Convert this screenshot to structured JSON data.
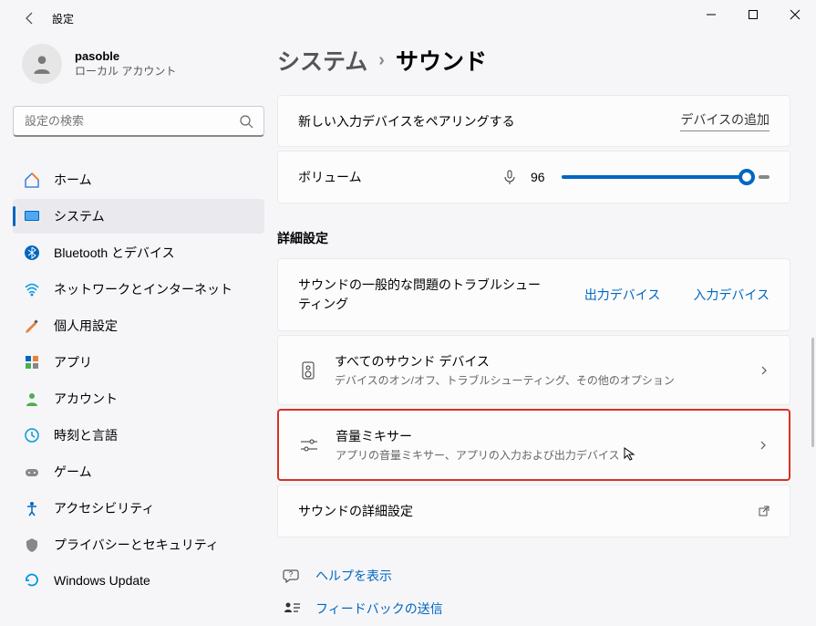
{
  "titlebar": {
    "title": "設定"
  },
  "profile": {
    "name": "pasoble",
    "subtitle": "ローカル アカウント"
  },
  "search": {
    "placeholder": "設定の検索"
  },
  "nav": [
    {
      "id": "home",
      "label": "ホーム"
    },
    {
      "id": "system",
      "label": "システム",
      "active": true
    },
    {
      "id": "bluetooth",
      "label": "Bluetooth とデバイス"
    },
    {
      "id": "network",
      "label": "ネットワークとインターネット"
    },
    {
      "id": "personalize",
      "label": "個人用設定"
    },
    {
      "id": "apps",
      "label": "アプリ"
    },
    {
      "id": "account",
      "label": "アカウント"
    },
    {
      "id": "time",
      "label": "時刻と言語"
    },
    {
      "id": "gaming",
      "label": "ゲーム"
    },
    {
      "id": "accessibility",
      "label": "アクセシビリティ"
    },
    {
      "id": "privacy",
      "label": "プライバシーとセキュリティ"
    },
    {
      "id": "update",
      "label": "Windows Update"
    }
  ],
  "breadcrumb": {
    "parent": "システム",
    "current": "サウンド"
  },
  "pairing": {
    "text": "新しい入力デバイスをペアリングする",
    "button": "デバイスの追加"
  },
  "volume": {
    "label": "ボリューム",
    "value": "96"
  },
  "advanced": {
    "title": "詳細設定",
    "troubleshoot": {
      "text": "サウンドの一般的な問題のトラブルシューティング",
      "output": "出力デバイス",
      "input": "入力デバイス"
    },
    "allDevices": {
      "title": "すべてのサウンド デバイス",
      "subtitle": "デバイスのオン/オフ、トラブルシューティング、その他のオプション"
    },
    "mixer": {
      "title": "音量ミキサー",
      "subtitle": "アプリの音量ミキサー、アプリの入力および出力デバイス"
    },
    "details": {
      "title": "サウンドの詳細設定"
    }
  },
  "links": {
    "help": "ヘルプを表示",
    "feedback": "フィードバックの送信"
  }
}
